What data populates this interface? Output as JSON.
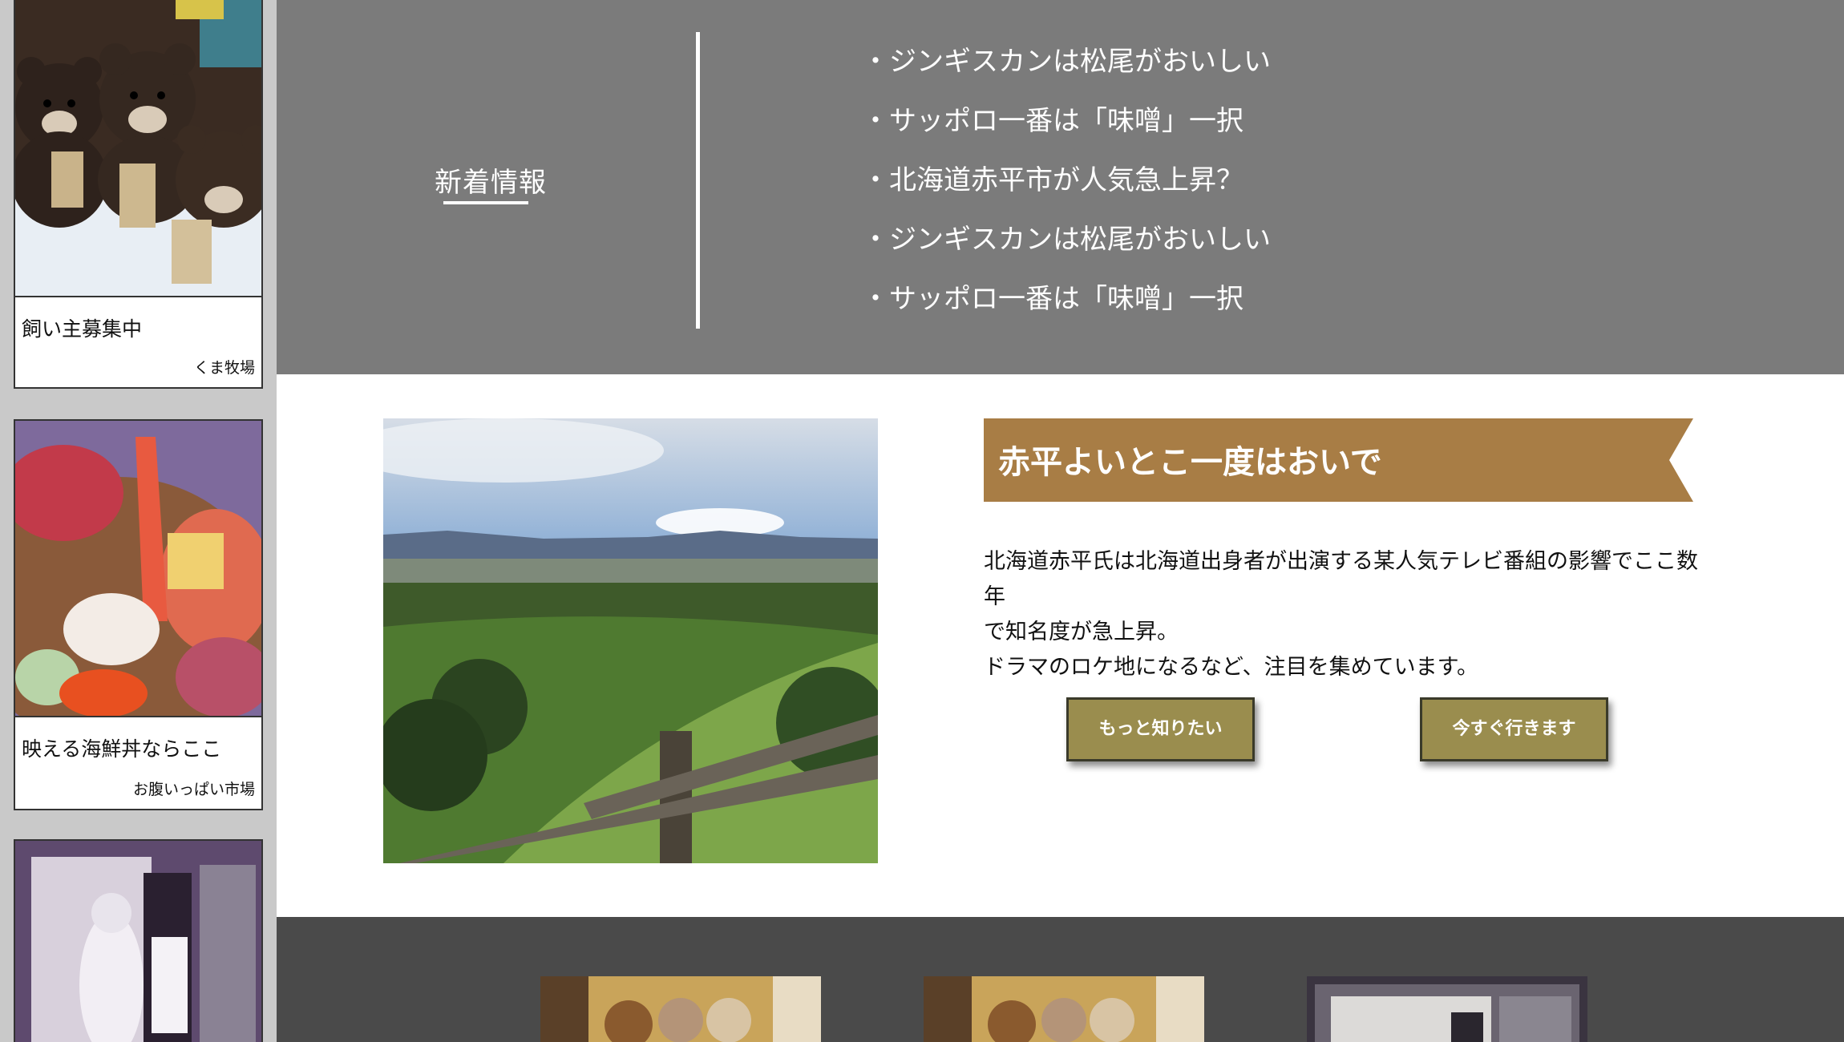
{
  "sidebar": {
    "cards": [
      {
        "caption": "飼い主募集中",
        "source": "くま牧場"
      },
      {
        "caption": "映える海鮮丼ならここ",
        "source": "お腹いっぱい市場"
      },
      {
        "caption": "",
        "source": ""
      }
    ]
  },
  "news": {
    "heading": "新着情報",
    "items": [
      "ジンギスカンは松尾がおいしい",
      "サッポロ一番は「味噌」一択",
      "北海道赤平市が人気急上昇？",
      "ジンギスカンは松尾がおいしい",
      "サッポロ一番は「味噌」一択"
    ]
  },
  "feature": {
    "title": "赤平よいとこ一度はおいで",
    "body_lines": [
      "北海道赤平氏は北海道出身者が出演する某人気テレビ番組の影響でここ数年",
      "で知名度が急上昇。",
      "ドラマのロケ地になるなど、注目を集めています。"
    ],
    "button_more": "もっと知りたい",
    "button_go": "今すぐ行きます"
  },
  "colors": {
    "news_bg": "#7b7b7b",
    "banner": "#a87d45",
    "button": "#9a8d4e",
    "gallery_bg": "#4a4a4a",
    "sidebar_bg": "#c9c9c9"
  }
}
